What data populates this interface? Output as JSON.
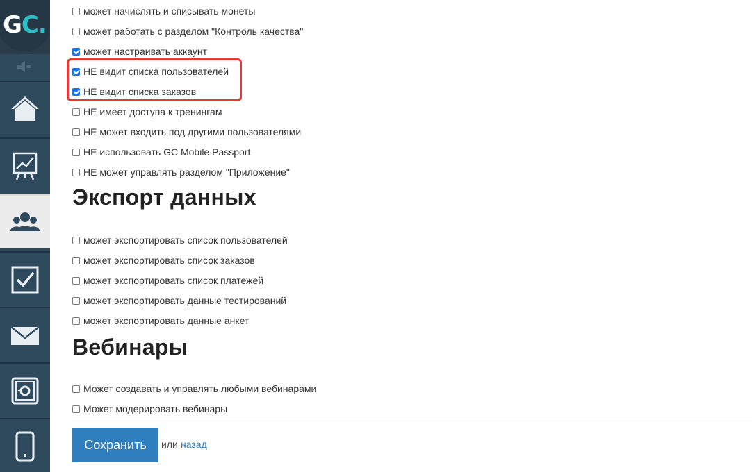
{
  "sidebar": {
    "logo": {
      "text_main": "G",
      "text_accent": "C",
      "dot": "."
    },
    "items": [
      {
        "icon": "home-icon",
        "active": false
      },
      {
        "icon": "chart-board-icon",
        "active": false
      },
      {
        "icon": "users-icon",
        "active": true
      },
      {
        "icon": "checkbox-task-icon",
        "active": false
      },
      {
        "icon": "mail-icon",
        "active": false
      },
      {
        "icon": "settings-safe-icon",
        "active": false
      },
      {
        "icon": "mobile-icon",
        "active": false
      }
    ]
  },
  "permissions": [
    {
      "label": "может начислять и списывать монеты",
      "checked": false
    },
    {
      "label": "может работать с разделом \"Контроль качества\"",
      "checked": false
    },
    {
      "label": "может настраивать аккаунт",
      "checked": true
    },
    {
      "label": "НЕ видит списка пользователей",
      "checked": true
    },
    {
      "label": "НЕ видит списка заказов",
      "checked": true
    },
    {
      "label": "НЕ имеет доступа к тренингам",
      "checked": false
    },
    {
      "label": "НЕ может входить под другими пользователями",
      "checked": false
    },
    {
      "label": "НЕ использовать GC Mobile Passport",
      "checked": false
    },
    {
      "label": "НЕ может управлять разделом \"Приложение\"",
      "checked": false
    }
  ],
  "export_section": {
    "title": "Экспорт данных",
    "items": [
      {
        "label": "может экспортировать список пользователей",
        "checked": false
      },
      {
        "label": "может экспортировать список заказов",
        "checked": false
      },
      {
        "label": "может экспортировать список платежей",
        "checked": false
      },
      {
        "label": "может экспортировать данные тестирований",
        "checked": false
      },
      {
        "label": "может экспортировать данные анкет",
        "checked": false
      }
    ]
  },
  "webinars_section": {
    "title": "Вебинары",
    "items": [
      {
        "label": "Может создавать и управлять любыми вебинарами",
        "checked": false
      },
      {
        "label": "Может модерировать вебинары",
        "checked": false
      }
    ]
  },
  "footer": {
    "save_label": "Сохранить",
    "or_text": "или",
    "back_label": "назад"
  },
  "colors": {
    "sidebar": "#2f4a5d",
    "accent": "#2bc0c8",
    "button": "#2f7fbf",
    "highlight": "#e53935",
    "checkbox_checked": "#1a73e8"
  }
}
